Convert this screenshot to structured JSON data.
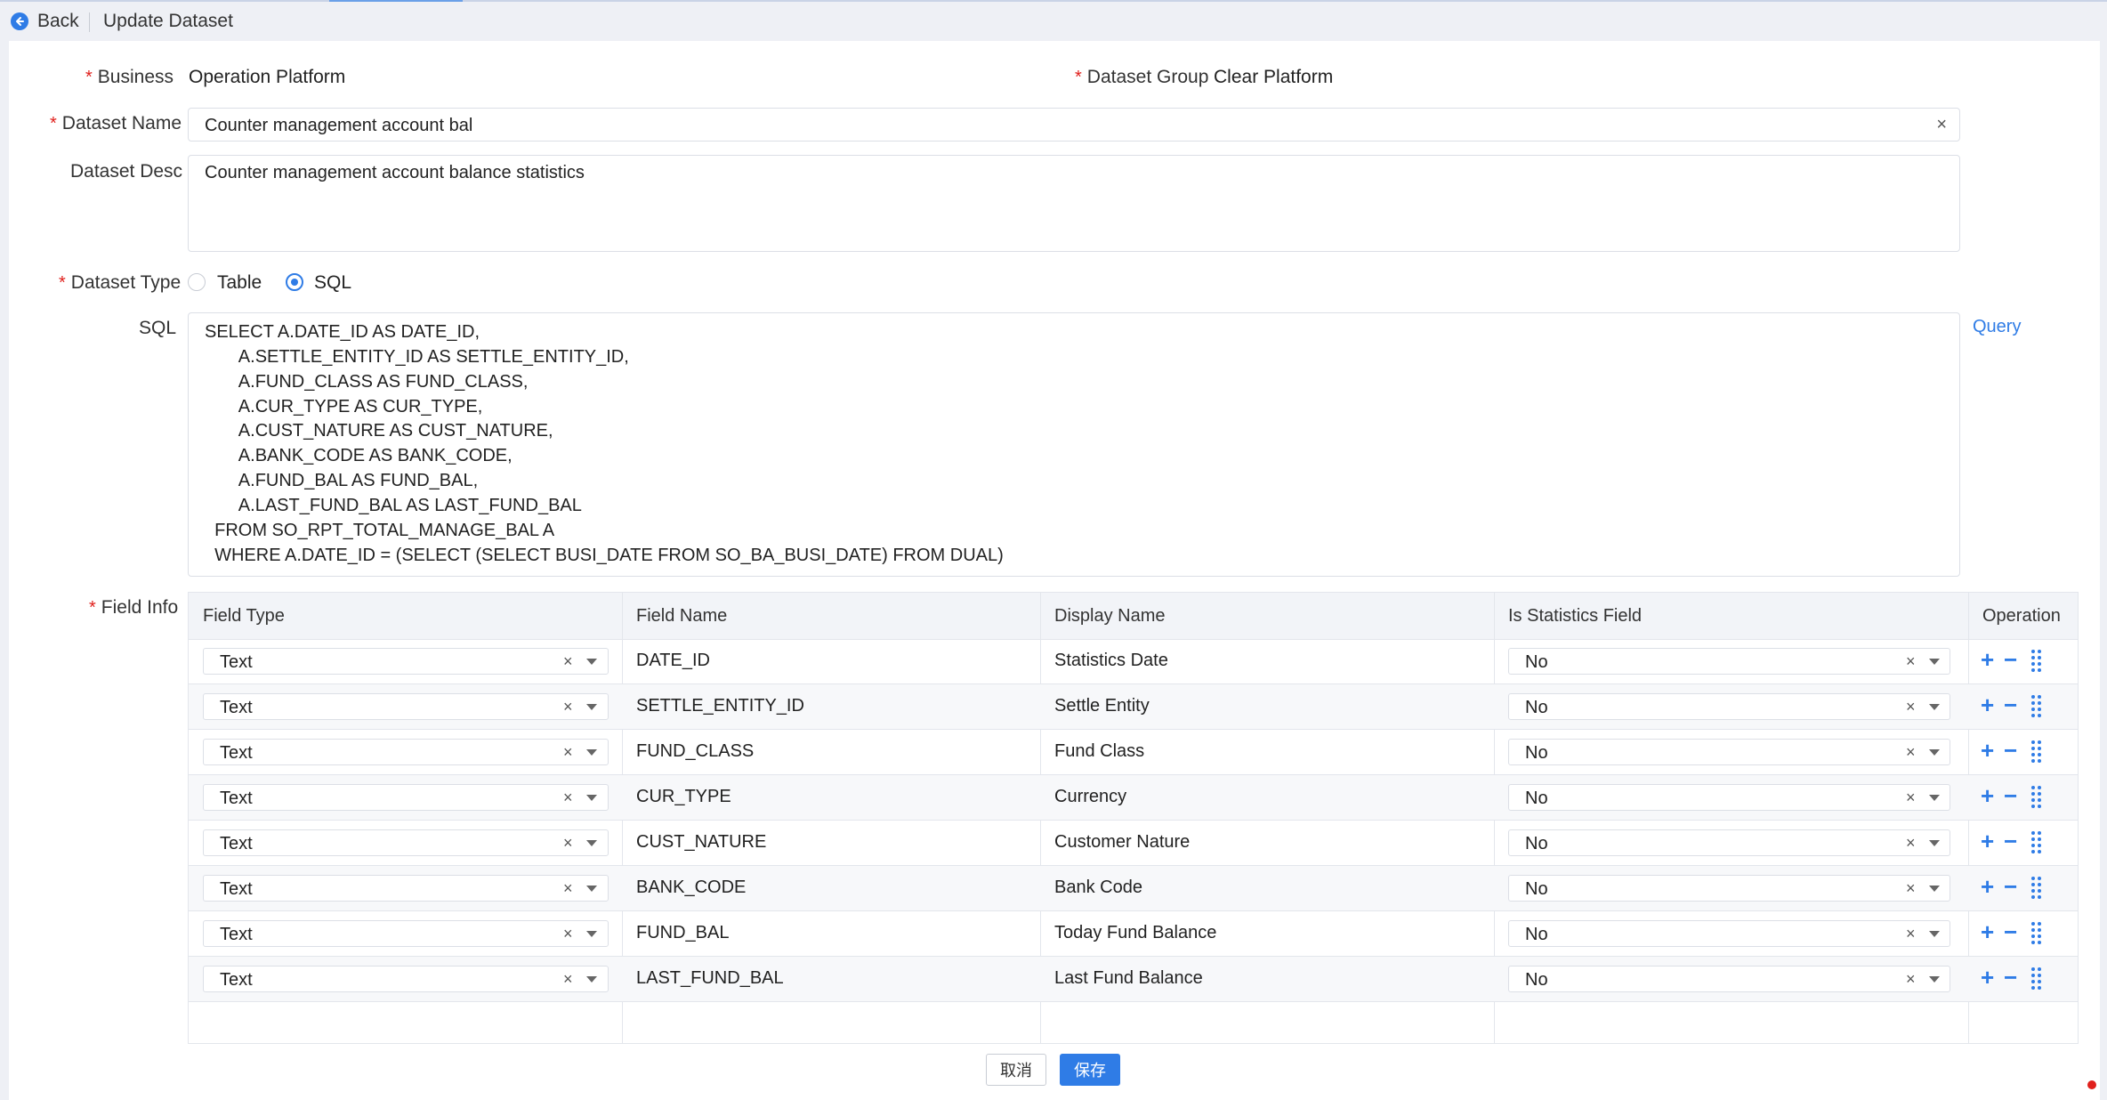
{
  "header": {
    "back_label": "Back",
    "title": "Update Dataset"
  },
  "form": {
    "business_label": "Business",
    "business_value": "Operation Platform",
    "dataset_group_label": "Dataset Group",
    "dataset_group_value": "Clear Platform",
    "dataset_name_label": "Dataset Name",
    "dataset_name_value": "Counter management account bal",
    "dataset_desc_label": "Dataset Desc",
    "dataset_desc_value": "Counter management account balance statistics",
    "dataset_type_label": "Dataset Type",
    "dataset_type_options": [
      "Table",
      "SQL"
    ],
    "dataset_type_selected": "SQL",
    "sql_label": "SQL",
    "sql_lines": [
      "SELECT A.DATE_ID AS DATE_ID,",
      "       A.SETTLE_ENTITY_ID AS SETTLE_ENTITY_ID,",
      "       A.FUND_CLASS AS FUND_CLASS,",
      "       A.CUR_TYPE AS CUR_TYPE,",
      "       A.CUST_NATURE AS CUST_NATURE,",
      "       A.BANK_CODE AS BANK_CODE,",
      "       A.FUND_BAL AS FUND_BAL,",
      "       A.LAST_FUND_BAL AS LAST_FUND_BAL",
      "  FROM SO_RPT_TOTAL_MANAGE_BAL A",
      "  WHERE A.DATE_ID = (SELECT (SELECT BUSI_DATE FROM SO_BA_BUSI_DATE) FROM DUAL)"
    ],
    "query_label": "Query",
    "field_info_label": "Field Info"
  },
  "table": {
    "columns": [
      "Field Type",
      "Field Name",
      "Display Name",
      "Is Statistics Field",
      "Operation"
    ],
    "rows": [
      {
        "field_type": "Text",
        "field_name": "DATE_ID",
        "display_name": "Statistics Date",
        "is_stat": "No"
      },
      {
        "field_type": "Text",
        "field_name": "SETTLE_ENTITY_ID",
        "display_name": "Settle Entity",
        "is_stat": "No"
      },
      {
        "field_type": "Text",
        "field_name": "FUND_CLASS",
        "display_name": "Fund Class",
        "is_stat": "No"
      },
      {
        "field_type": "Text",
        "field_name": "CUR_TYPE",
        "display_name": "Currency",
        "is_stat": "No"
      },
      {
        "field_type": "Text",
        "field_name": "CUST_NATURE",
        "display_name": "Customer Nature",
        "is_stat": "No"
      },
      {
        "field_type": "Text",
        "field_name": "BANK_CODE",
        "display_name": "Bank Code",
        "is_stat": "No"
      },
      {
        "field_type": "Text",
        "field_name": "FUND_BAL",
        "display_name": "Today Fund Balance",
        "is_stat": "No"
      },
      {
        "field_type": "Text",
        "field_name": "LAST_FUND_BAL",
        "display_name": "Last Fund Balance",
        "is_stat": "No"
      }
    ]
  },
  "footer": {
    "cancel_label": "取消",
    "save_label": "保存"
  },
  "icons": {
    "clear": "×",
    "add": "+",
    "remove": "−"
  },
  "colors": {
    "accent": "#2f7ce6",
    "required": "#e0201c"
  }
}
